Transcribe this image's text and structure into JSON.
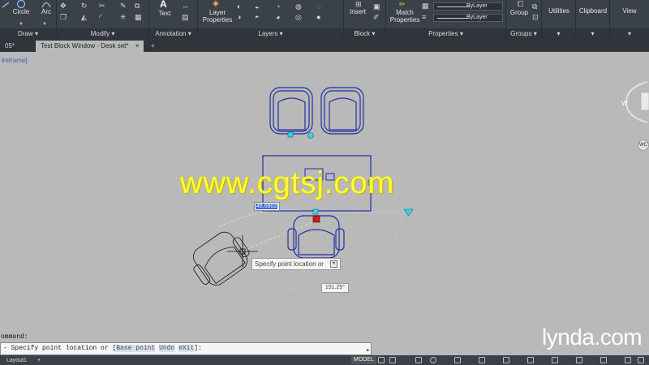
{
  "ribbon": {
    "draw": {
      "circle_label": "Circle",
      "arc_label": "Arc",
      "footer": "Draw ▾"
    },
    "modify": {
      "footer": "Modify ▾"
    },
    "annotation": {
      "text_label": "Text",
      "footer": "Annotation ▾"
    },
    "layers": {
      "layer_properties_label_1": "Layer",
      "layer_properties_label_2": "Properties",
      "footer": "Layers ▾"
    },
    "block": {
      "insert_label": "Insert",
      "footer": "Block ▾"
    },
    "properties": {
      "match_label_1": "Match",
      "match_label_2": "Properties",
      "bylayer_1": "ByLayer",
      "bylayer_2": "ByLayer",
      "footer": "Properties ▾"
    },
    "groups": {
      "group_label": "Group",
      "footer": "Groups ▾"
    },
    "utilities": {
      "label": "Utilities"
    },
    "clipboard": {
      "label": "Clipboard"
    },
    "view": {
      "label": "View"
    }
  },
  "tabs": {
    "previous": "05*",
    "active": "Test Block Window - Desk set*",
    "close": "×",
    "add": "+"
  },
  "viewport": {
    "label": "ireframe]"
  },
  "dynamic_input": {
    "value": "46.6802",
    "prompt": "Specify point location or",
    "angle": "151.25°"
  },
  "viewcube": {
    "w_label": "W",
    "wcs_label": "WC"
  },
  "watermark": "www.cgtsj.com",
  "command": {
    "history": "ommand:",
    "prompt_prefix": "- Specify point location or [",
    "opt_base": "Base point",
    "opt_undo": "Undo",
    "opt_exit": "eXit",
    "prompt_suffix": "]:"
  },
  "statusbar": {
    "layout_tab": "Layout1",
    "add": "+",
    "model": "MODEL"
  },
  "logo": "lynda.com"
}
